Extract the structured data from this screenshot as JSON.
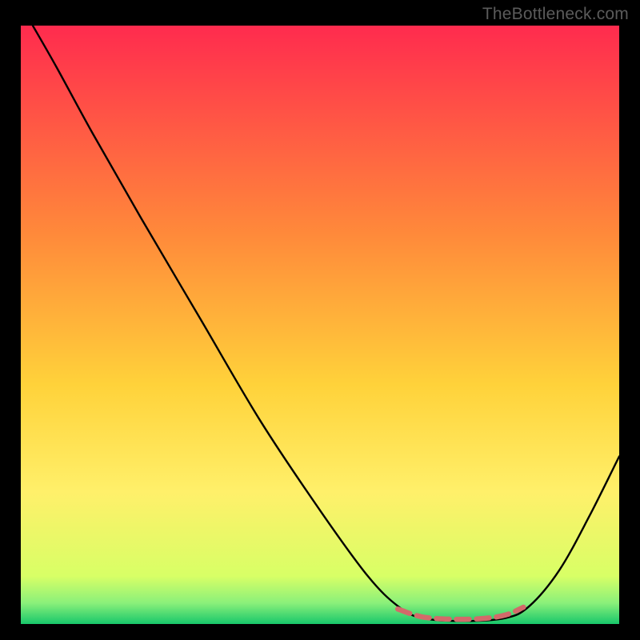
{
  "watermark": "TheBottleneck.com",
  "chart_data": {
    "type": "line",
    "title": "",
    "xlabel": "",
    "ylabel": "",
    "xlim": [
      0,
      100
    ],
    "ylim": [
      0,
      100
    ],
    "grid": false,
    "legend": null,
    "background_gradient_stops": [
      {
        "offset": 0.0,
        "color": "#ff2b4e"
      },
      {
        "offset": 0.35,
        "color": "#ff8a3a"
      },
      {
        "offset": 0.6,
        "color": "#ffd23a"
      },
      {
        "offset": 0.78,
        "color": "#fff06a"
      },
      {
        "offset": 0.92,
        "color": "#d8ff66"
      },
      {
        "offset": 0.965,
        "color": "#8af07a"
      },
      {
        "offset": 1.0,
        "color": "#18c76b"
      }
    ],
    "series": [
      {
        "name": "bottleneck-curve",
        "stroke": "#000000",
        "stroke_width": 2.4,
        "points": [
          {
            "x": 2.0,
            "y": 100.0
          },
          {
            "x": 6.0,
            "y": 93.0
          },
          {
            "x": 12.0,
            "y": 82.0
          },
          {
            "x": 20.0,
            "y": 68.0
          },
          {
            "x": 30.0,
            "y": 51.0
          },
          {
            "x": 40.0,
            "y": 34.0
          },
          {
            "x": 50.0,
            "y": 19.0
          },
          {
            "x": 58.0,
            "y": 8.0
          },
          {
            "x": 63.0,
            "y": 3.0
          },
          {
            "x": 67.0,
            "y": 1.0
          },
          {
            "x": 74.0,
            "y": 0.5
          },
          {
            "x": 81.0,
            "y": 1.0
          },
          {
            "x": 85.0,
            "y": 3.0
          },
          {
            "x": 90.0,
            "y": 9.0
          },
          {
            "x": 95.0,
            "y": 18.0
          },
          {
            "x": 100.0,
            "y": 28.0
          }
        ]
      },
      {
        "name": "optimal-range-marker",
        "stroke": "#d36a6a",
        "stroke_width": 6.5,
        "dash": [
          16,
          9
        ],
        "points": [
          {
            "x": 63.0,
            "y": 2.5
          },
          {
            "x": 67.0,
            "y": 1.2
          },
          {
            "x": 72.0,
            "y": 0.8
          },
          {
            "x": 77.0,
            "y": 0.9
          },
          {
            "x": 81.0,
            "y": 1.5
          },
          {
            "x": 84.0,
            "y": 2.8
          }
        ]
      }
    ]
  }
}
